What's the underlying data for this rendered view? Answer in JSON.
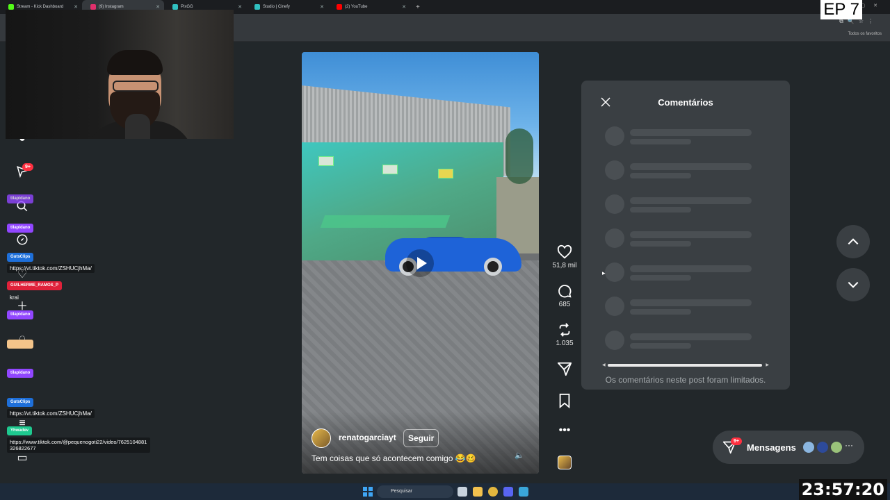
{
  "browser": {
    "tabs": [
      {
        "label": "Stream - Kick Dashboard",
        "color": "#53fc18"
      },
      {
        "label": "(9) Instagram",
        "color": "#e1306c"
      },
      {
        "label": "PixGG",
        "color": "#30c0c0"
      },
      {
        "label": "Studio | Cinefy",
        "color": "#30c0c0"
      },
      {
        "label": "(2) YouTube",
        "color": "#ff0000"
      }
    ],
    "bookmarks_label": "Todos os favoritos"
  },
  "overlay": {
    "episode": "EP 7",
    "clock": "23:57:20"
  },
  "sidebar": {
    "notif_badge": "9+"
  },
  "chat": [
    {
      "user": "tilapidano",
      "color": "#9146ff",
      "message": ""
    },
    {
      "user": "tilapidano",
      "color": "#9146ff",
      "message": ""
    },
    {
      "user": "GutsClips",
      "color": "#1e6fd9",
      "message": "https://vt.tiktok.com/ZSHUCjhMa/"
    },
    {
      "user": "GUILHERME_RAMOS_P",
      "color": "#e0213a",
      "message": "krai"
    },
    {
      "user": "tilapidano",
      "color": "#9146ff",
      "message": ""
    },
    {
      "user": "",
      "color": "#f4c48a",
      "message": ""
    },
    {
      "user": "tilapidano",
      "color": "#9146ff",
      "message": ""
    },
    {
      "user": "GutsClips",
      "color": "#1e6fd9",
      "message": "https://vt.tiktok.com/ZSHUCjhMa/"
    },
    {
      "user": "Yhwadev",
      "color": "#1ec98f",
      "message": "https://www.tiktok.com/@pequenogoti22/video/7625104881326822677"
    }
  ],
  "video": {
    "username": "renatogarciayt",
    "follow_label": "Seguir",
    "caption": "Tem coisas que só acontecem comigo 😂🥴"
  },
  "actions": {
    "likes": "51,8 mil",
    "comments": "685",
    "reposts": "1.035"
  },
  "comments_panel": {
    "title": "Comentários",
    "limited_notice": "Os comentários neste post foram limitados."
  },
  "messages": {
    "label": "Mensagens",
    "badge": "9+"
  },
  "taskbar": {
    "search_placeholder": "Pesquisar"
  }
}
